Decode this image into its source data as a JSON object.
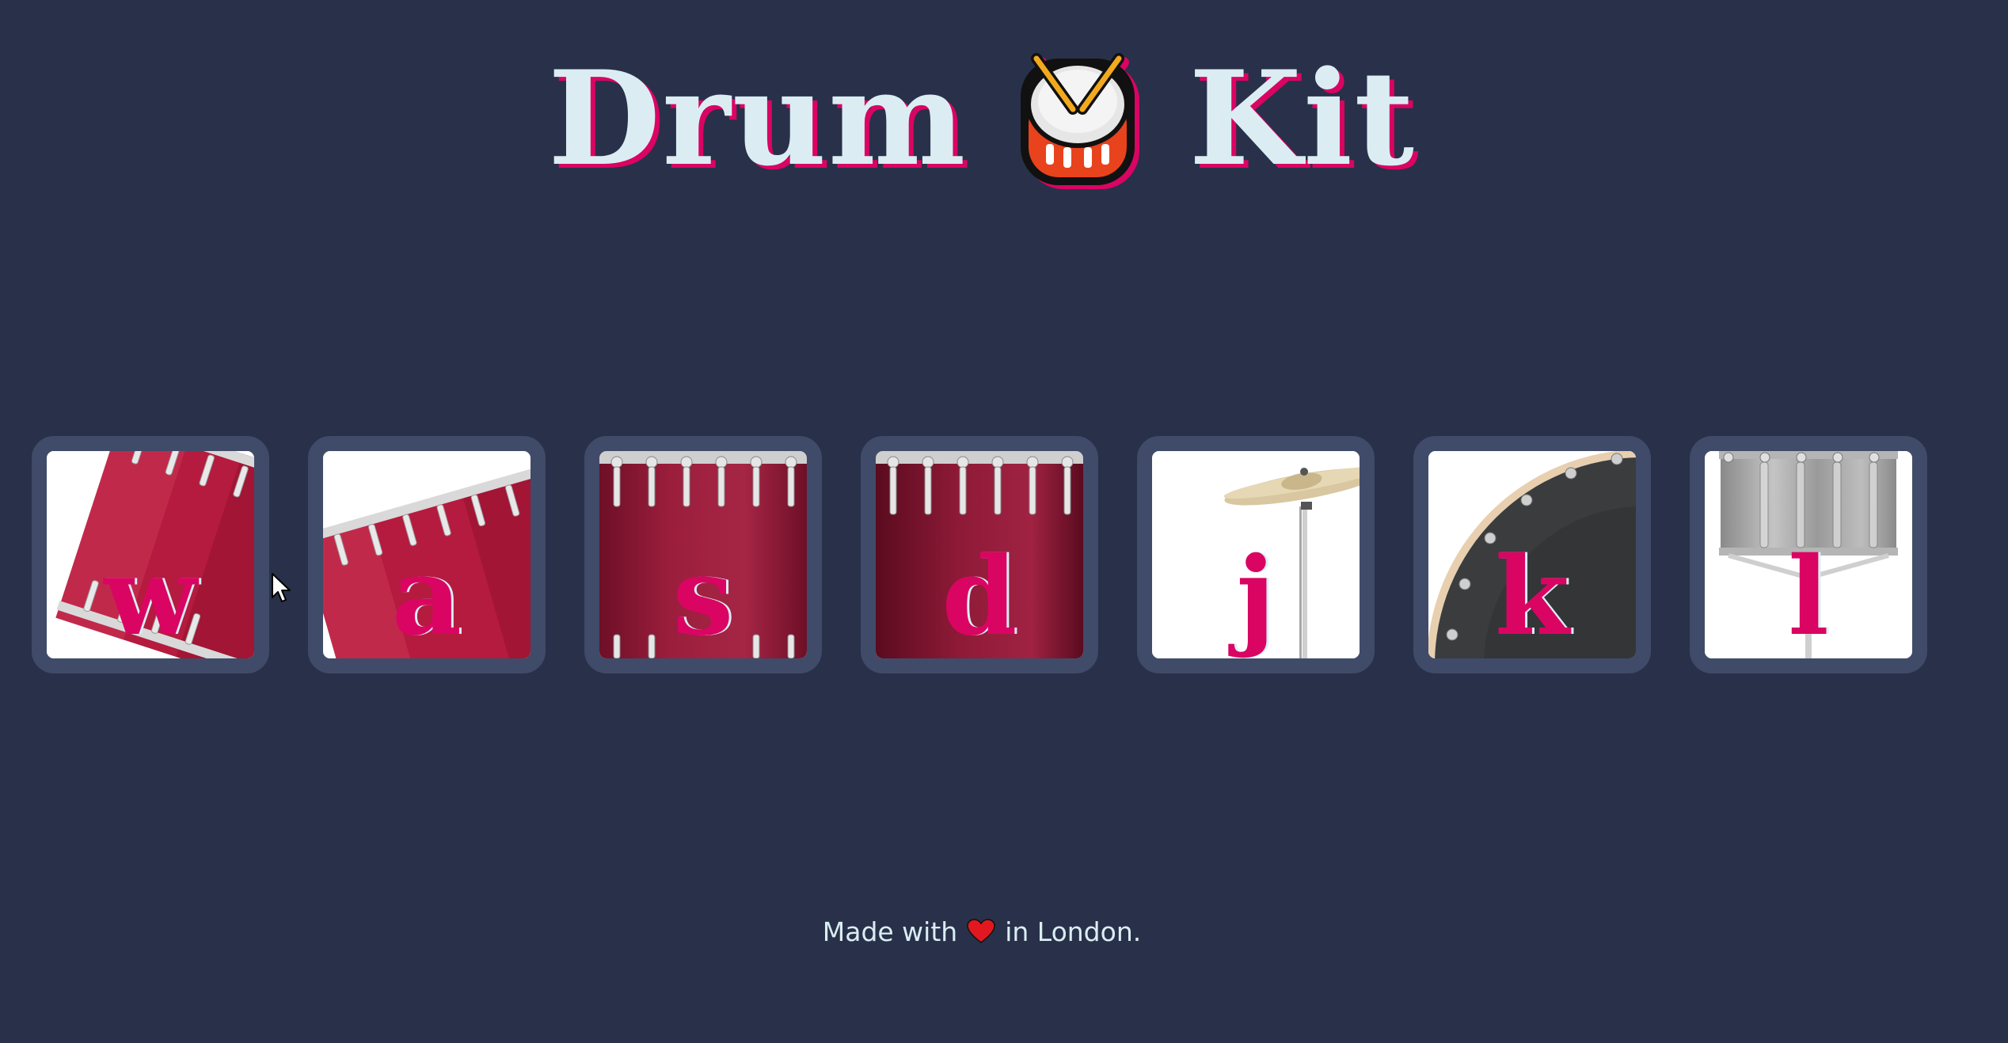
{
  "header": {
    "title_left": "Drum",
    "title_icon": "drum-emoji-icon",
    "title_right": "Kit"
  },
  "drums": [
    {
      "key": "w",
      "art": "tom-1",
      "icon": "tom-drum-icon"
    },
    {
      "key": "a",
      "art": "tom-2",
      "icon": "tom-drum-icon"
    },
    {
      "key": "s",
      "art": "tom-3",
      "icon": "floor-tom-icon"
    },
    {
      "key": "d",
      "art": "tom-4",
      "icon": "floor-tom-icon"
    },
    {
      "key": "j",
      "art": "crash",
      "icon": "cymbal-icon"
    },
    {
      "key": "k",
      "art": "kick",
      "icon": "bass-drum-icon"
    },
    {
      "key": "l",
      "art": "snare",
      "icon": "snare-drum-icon"
    }
  ],
  "footer": {
    "text_before": "Made with",
    "heart_icon": "heart-icon",
    "text_after": "in London."
  },
  "colors": {
    "background": "#283149",
    "button_border": "#404B69",
    "accent": "#DA0463",
    "title_text": "#DBEDF3"
  }
}
